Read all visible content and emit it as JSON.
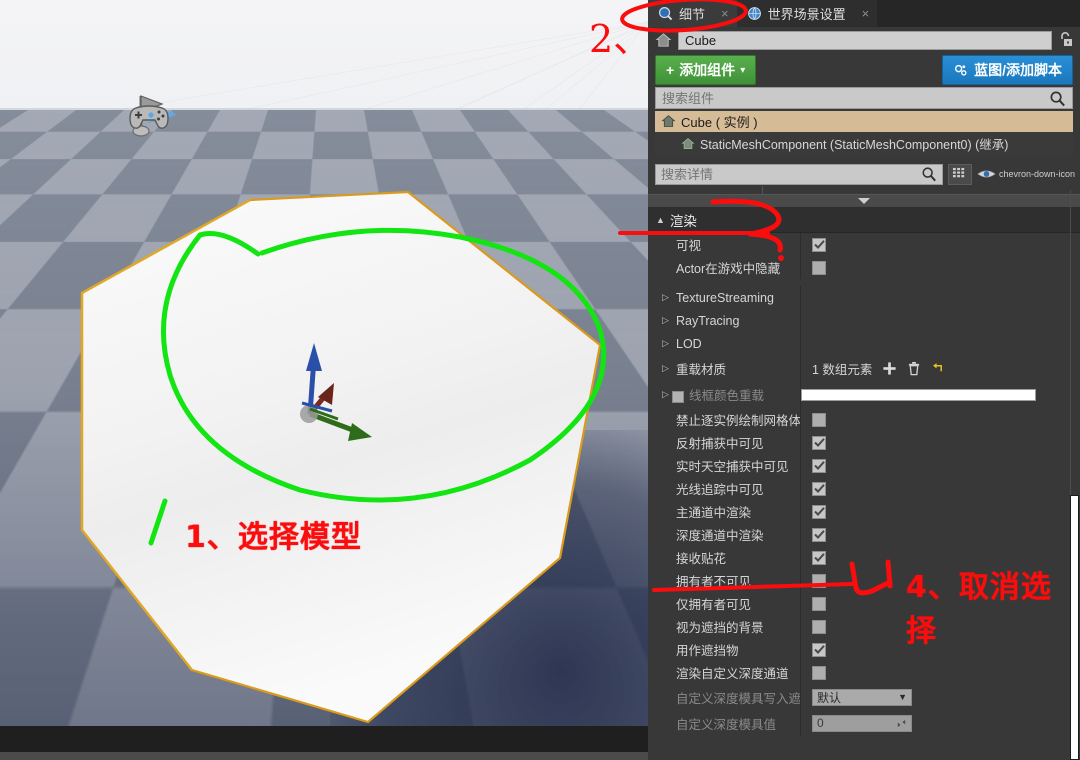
{
  "tabs": [
    {
      "label": "细节",
      "icon": "details-magnifier-icon",
      "active": true,
      "close": "×"
    },
    {
      "label": "世界场景设置",
      "icon": "globe-icon",
      "active": false,
      "close": "×"
    }
  ],
  "actor": {
    "home_icon": "home-icon",
    "name_value": "Cube",
    "lock_icon": "lock-open-icon"
  },
  "toolbar": {
    "add_component_label": "添加组件",
    "add_component_plus": "+",
    "add_component_caret": "▾",
    "blueprint_label": "蓝图/添加脚本",
    "blueprint_icon": "gear-blueprint-icon",
    "add_component_color": "#4ba043",
    "blueprint_color": "#1f82c8"
  },
  "component_search": {
    "placeholder": "搜索组件",
    "search_icon": "search-icon"
  },
  "component_tree": [
    {
      "label": "Cube ( 实例 )",
      "icon": "home-icon",
      "selected": true
    },
    {
      "label": "StaticMeshComponent (StaticMeshComponent0) (继承)",
      "icon": "home-icon",
      "selected": false
    }
  ],
  "details_search": {
    "placeholder": "搜索详情",
    "search_icon": "search-icon",
    "grid_icon": "grid-view-icon",
    "eye_icon": "eye-icon",
    "caret_icon": "chevron-down-icon"
  },
  "collapse_bar": {
    "icon": "collapse-arrow-icon"
  },
  "categories": [
    {
      "name": "渲染",
      "expanded": true,
      "arrow": "▲",
      "rows": [
        {
          "label": "可视",
          "type": "checkbox",
          "checked": true,
          "dim": false,
          "arrow": null
        },
        {
          "label": "Actor在游戏中隐藏",
          "type": "checkbox",
          "checked": false,
          "dim": false,
          "arrow": null
        }
      ]
    }
  ],
  "group_rows": [
    {
      "label": "TextureStreaming",
      "arrow": "▷",
      "type": "group"
    },
    {
      "label": "RayTracing",
      "arrow": "▷",
      "type": "group"
    },
    {
      "label": "LOD",
      "arrow": "▷",
      "type": "group"
    },
    {
      "label": "重载材质",
      "arrow": "▷",
      "type": "array",
      "value": "1 数组元素",
      "plus_icon": "plus-icon",
      "trash_icon": "trash-icon",
      "reset_icon": "reset-arrow-icon"
    },
    {
      "label": "线框颜色重载",
      "arrow": "▷",
      "type": "colorbar",
      "dim": true,
      "swatch_icon": "color-swatch-icon",
      "bar_color": "#ffffff"
    }
  ],
  "toggle_rows": [
    {
      "label": "禁止逐实例绘制网格体",
      "checked": false
    },
    {
      "label": "反射捕获中可见",
      "checked": true
    },
    {
      "label": "实时天空捕获中可见",
      "checked": true
    },
    {
      "label": "光线追踪中可见",
      "checked": true
    },
    {
      "label": "主通道中渲染",
      "checked": true
    },
    {
      "label": "深度通道中渲染",
      "checked": true
    },
    {
      "label": "接收贴花",
      "checked": true
    },
    {
      "label": "拥有者不可见",
      "checked": false
    },
    {
      "label": "仅拥有者可见",
      "checked": false
    },
    {
      "label": "视为遮挡的背景",
      "checked": false
    },
    {
      "label": "用作遮挡物",
      "checked": true
    },
    {
      "label": "渲染自定义深度通道",
      "checked": false
    }
  ],
  "dim_rows": [
    {
      "label": "自定义深度模具写入遮罩",
      "type": "combo",
      "value": "默认",
      "caret": "▼"
    },
    {
      "label": "自定义深度模具值",
      "type": "number",
      "value": "0",
      "spin_icon": "spinner-icon"
    }
  ],
  "annotations": [
    {
      "id": "1",
      "text": "1、选择模型",
      "color": "#fb0d0d",
      "stroke_color": "#12e512"
    },
    {
      "id": "2",
      "text": "2、",
      "color": "#fb0d0d"
    },
    {
      "id": "3",
      "text": "3",
      "color": "#fb0d0d"
    },
    {
      "id": "4",
      "text": "4、取消选择",
      "color": "#fb0d0d"
    }
  ],
  "viewport": {
    "selection_outline_color": "#d99a1d",
    "gizmo_axes": [
      "z-blue",
      "x-red",
      "y-green"
    ],
    "player_start_icon": "player-start-icon",
    "floor_checker_colors": [
      "#a9aeb9",
      "#7e8694"
    ]
  },
  "scrollbar": {
    "thumb_color": "#ffffff"
  }
}
